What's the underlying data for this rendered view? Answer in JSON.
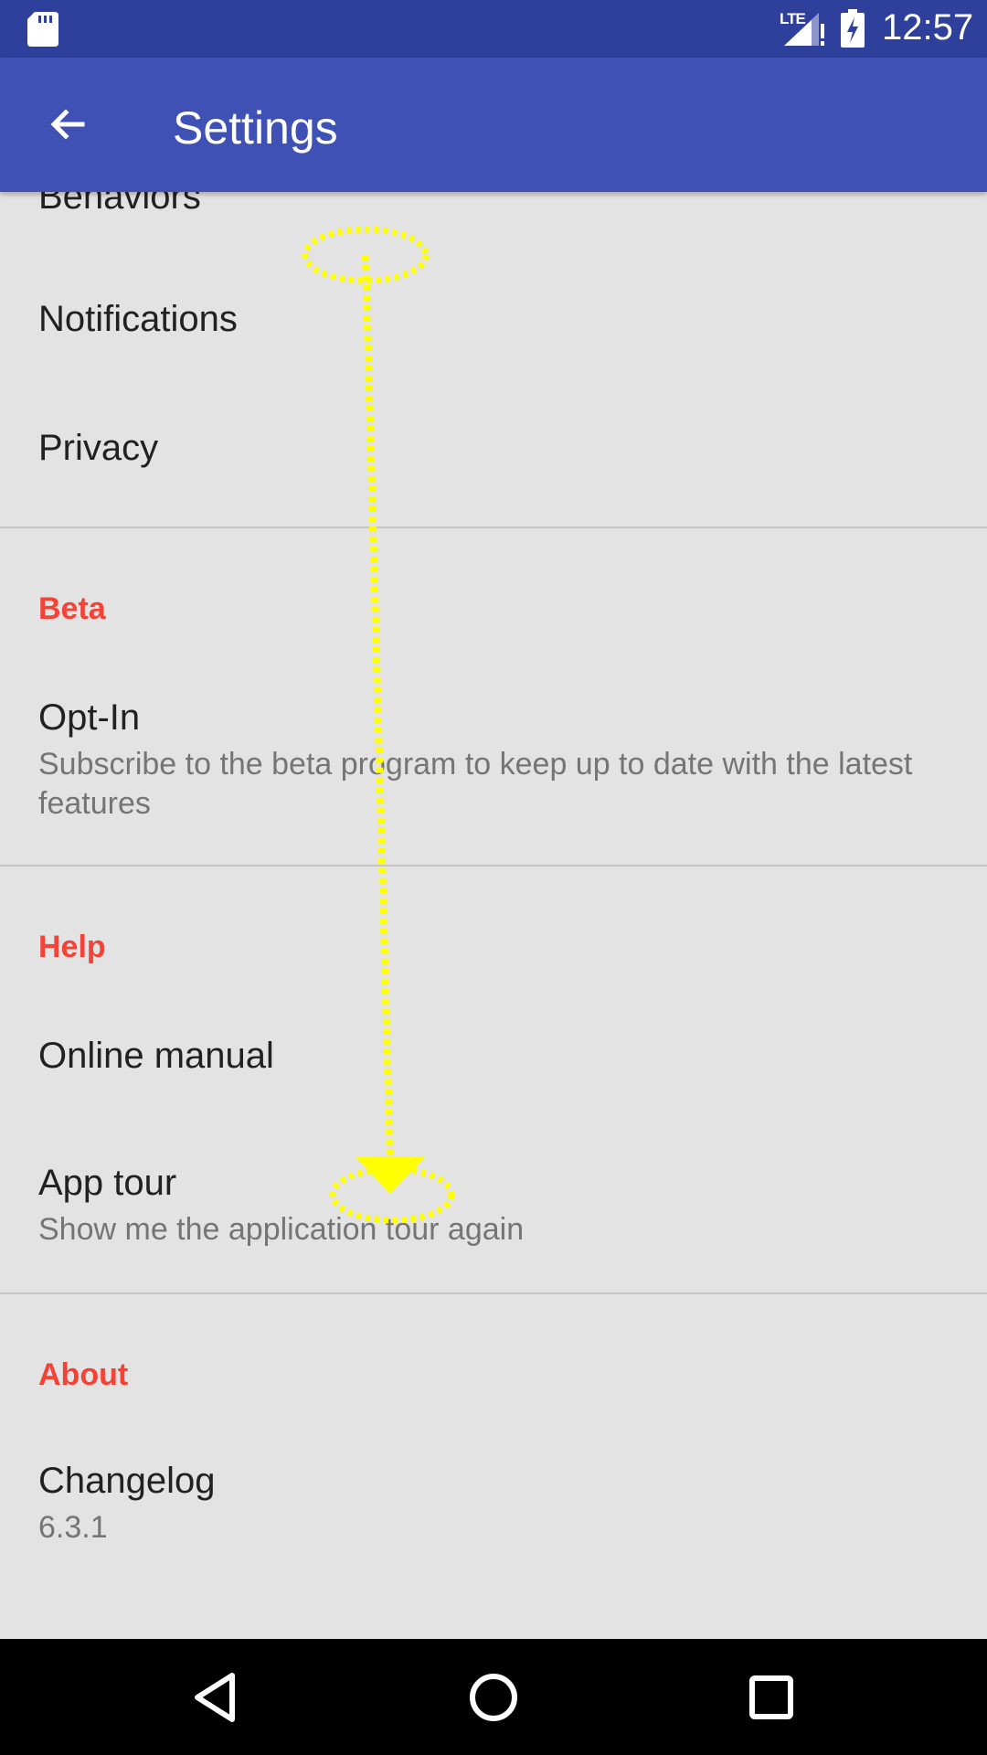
{
  "status_bar": {
    "network": "LTE",
    "time": "12:57",
    "icons": [
      "sd-card-icon",
      "signal-icon",
      "battery-charging-icon"
    ]
  },
  "app_bar": {
    "title": "Settings",
    "back_icon": "arrow-back-icon"
  },
  "items": {
    "behaviors": "Behaviors",
    "notifications": "Notifications",
    "privacy": "Privacy",
    "beta_header": "Beta",
    "optin_title": "Opt-In",
    "optin_summary": "Subscribe to the beta program to keep up to date with the latest features",
    "help_header": "Help",
    "manual": "Online manual",
    "tour_title": "App tour",
    "tour_summary": "Show me the application tour again",
    "about_header": "About",
    "changelog_title": "Changelog",
    "changelog_summary": "6.3.1"
  },
  "colors": {
    "status_bar": "#2e3f9c",
    "app_bar": "#3f51b5",
    "section_header": "#f44336",
    "background": "#e3e3e3",
    "gesture": "#ffff00"
  },
  "gesture": {
    "type": "swipe-down",
    "icon": "swipe-arrow-icon"
  },
  "nav_bar": {
    "icons": [
      "back-triangle-icon",
      "home-circle-icon",
      "recents-square-icon"
    ]
  }
}
